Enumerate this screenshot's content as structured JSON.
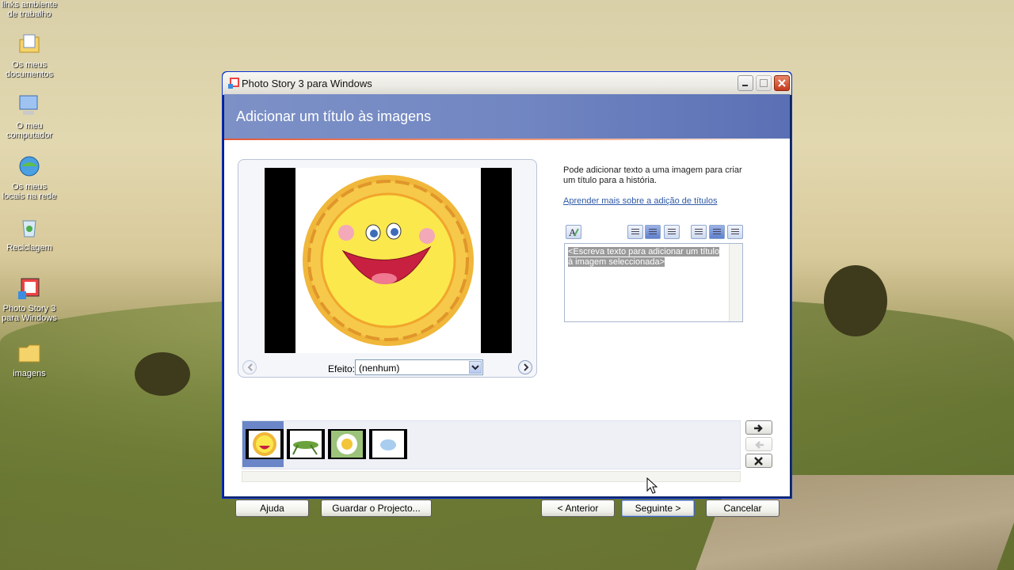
{
  "desktop": {
    "icons": [
      {
        "label": "links ambiente de trabalho"
      },
      {
        "label": "Os meus documentos"
      },
      {
        "label": "O meu computador"
      },
      {
        "label": "Os meus locais na rede"
      },
      {
        "label": "Reciclagem"
      },
      {
        "label": "Photo Story 3 para Windows"
      },
      {
        "label": "imagens"
      }
    ]
  },
  "window": {
    "title": "Photo Story 3 para Windows",
    "header": "Adicionar um título às imagens",
    "preview": {
      "effect_label": "Efeito:",
      "effect_value": "(nenhum)"
    },
    "info_text": "Pode adicionar texto a uma imagem para criar um título para a história.",
    "learn_link": "Aprender mais sobre a adição de títulos",
    "title_placeholder": "<Escreva texto para adicionar um título à imagem seleccionada>",
    "buttons": {
      "help": "Ajuda",
      "save": "Guardar o Projecto...",
      "back": "< Anterior",
      "next": "Seguinte >",
      "cancel": "Cancelar"
    }
  },
  "colors": {
    "header_band": "#7287c2",
    "link": "#2f5aa6",
    "selection": "#6b86c8"
  }
}
